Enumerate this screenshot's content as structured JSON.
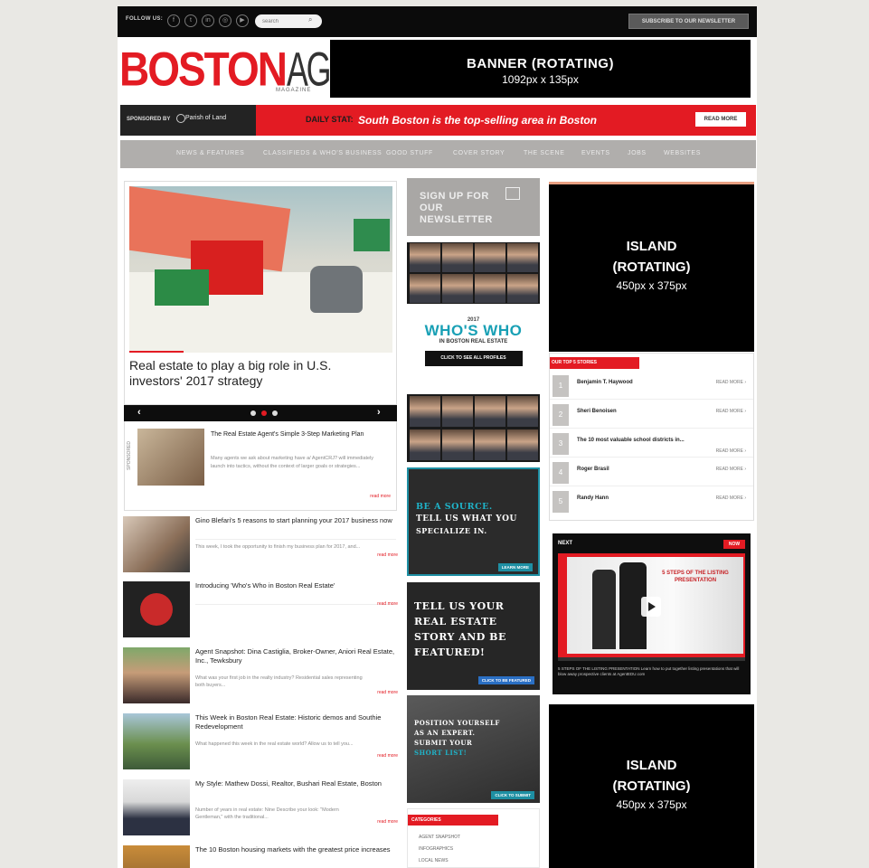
{
  "topbar": {
    "follow_label": "FOLLOW US:",
    "search_placeholder": "search",
    "subscribe_label": "SUBSCRIBE TO OUR NEWSLETTER"
  },
  "logo": {
    "part1": "BOSTON",
    "part2": "AGENT",
    "sub": "MAGAZINE"
  },
  "banner": {
    "line1": "BANNER (ROTATING)",
    "line2": "1092px x 135px"
  },
  "sponsor": {
    "sponsored_by": "SPONSORED BY",
    "sponsor_name": "Parish of Land",
    "stat_label": "DAILY STAT:",
    "stat_text": "South Boston is the top-selling area in Boston",
    "read_more": "READ MORE"
  },
  "nav": [
    "NEWS & FEATURES",
    "CLASSIFIEDS & WHO'S BUSINESS",
    "GOOD STUFF",
    "COVER STORY",
    "THE SCENE",
    "EVENTS",
    "JOBS",
    "WEBSITES"
  ],
  "featured": {
    "title": "Real estate to play a big role in U.S. investors' 2017 strategy",
    "prev": "‹",
    "next": "›"
  },
  "mini": {
    "side": "SPONSORED",
    "title": "The Real Estate Agent's Simple 3-Step Marketing Plan",
    "text": "Many agents we ask about marketing have a/ AgentCRJ? will immediately launch into tactics, without the context of larger goals or strategies...",
    "more": "read more"
  },
  "articles": [
    {
      "title": "Gino Blefari's 5 reasons to start planning your 2017 business now",
      "text": "This week, I took the opportunity to finish my business plan for 2017, and...",
      "more": "read more"
    },
    {
      "title": "Introducing 'Who's Who in Boston Real Estate'",
      "text": "",
      "more": "read more"
    },
    {
      "title": "Agent Snapshot: Dina Castiglia, Broker-Owner, Aniori Real Estate, Inc., Tewksbury",
      "text": "What was your first job in the realty industry? Residential sales representing both buyers...",
      "more": "read more"
    },
    {
      "title": "This Week in Boston Real Estate: Historic demos and Southie Redevelopment",
      "text": "What happened this week in the real estate world? Allow us to tell you...",
      "more": "read more"
    },
    {
      "title": "My Style: Mathew Dossi, Realtor, Bushari Real Estate, Boston",
      "text": "Number of years in real estate: Nine Describe your look: \"Modern Gentleman,\" with the traditional...",
      "more": "read more"
    },
    {
      "title": "The 10 Boston housing markets with the greatest price increases",
      "text": "",
      "more": ""
    }
  ],
  "middle": {
    "newsletter": "SIGN UP FOR OUR NEWSLETTER",
    "whoswho_year": "2017",
    "whoswho_title": "WHO'S WHO",
    "whoswho_sub": "IN BOSTON REAL ESTATE",
    "whoswho_btn": "CLICK TO SEE ALL PROFILES",
    "promo1_lines": [
      "BE A SOURCE.",
      "TELL US WHAT YOU",
      "SPECIALIZE IN."
    ],
    "promo1_btn": "LEARN MORE",
    "promo2_lines": [
      "TELL US YOUR",
      "REAL ESTATE",
      "STORY AND BE",
      "FEATURED!"
    ],
    "promo2_btn": "CLICK TO BE FEATURED",
    "promo3_lines": [
      "POSITION YOURSELF",
      "AS AN EXPERT.",
      "SUBMIT YOUR",
      "SHORT LIST!"
    ],
    "promo3_btn": "CLICK TO SUBMIT",
    "categories_label": "CATEGORIES",
    "categories": [
      "AGENT SNAPSHOT",
      "INFOGRAPHICS",
      "LOCAL NEWS"
    ]
  },
  "island1": {
    "line1": "ISLAND",
    "line2": "(ROTATING)",
    "line3": "450px x 375px"
  },
  "island2": {
    "line1": "ISLAND",
    "line2": "(ROTATING)",
    "line3": "450px x 375px"
  },
  "top5": {
    "label": "OUR TOP 5 STORIES",
    "items": [
      {
        "num": "1",
        "name": "Benjamin T. Haywood",
        "more": "READ MORE ›"
      },
      {
        "num": "2",
        "name": "Sheri Benoisen",
        "more": "READ MORE ›"
      },
      {
        "num": "3",
        "name": "The 10 most valuable school districts in...",
        "more": "READ MORE ›"
      },
      {
        "num": "4",
        "name": "Roger Brasil",
        "more": "READ MORE ›"
      },
      {
        "num": "5",
        "name": "Randy Hann",
        "more": "READ MORE ›"
      }
    ]
  },
  "video": {
    "next": "NEXT",
    "now": "NOW",
    "screen_title": "5 STEPS OF THE LISTING PRESENTATION",
    "caption": "5 STEPS OF THE LISTING PRESENTATION Learn how to put together listing presentations that will blow away prospective clients at AgentEDU.com"
  },
  "colors": {
    "brand_red": "#e31b23",
    "teal": "#19a0b5"
  }
}
